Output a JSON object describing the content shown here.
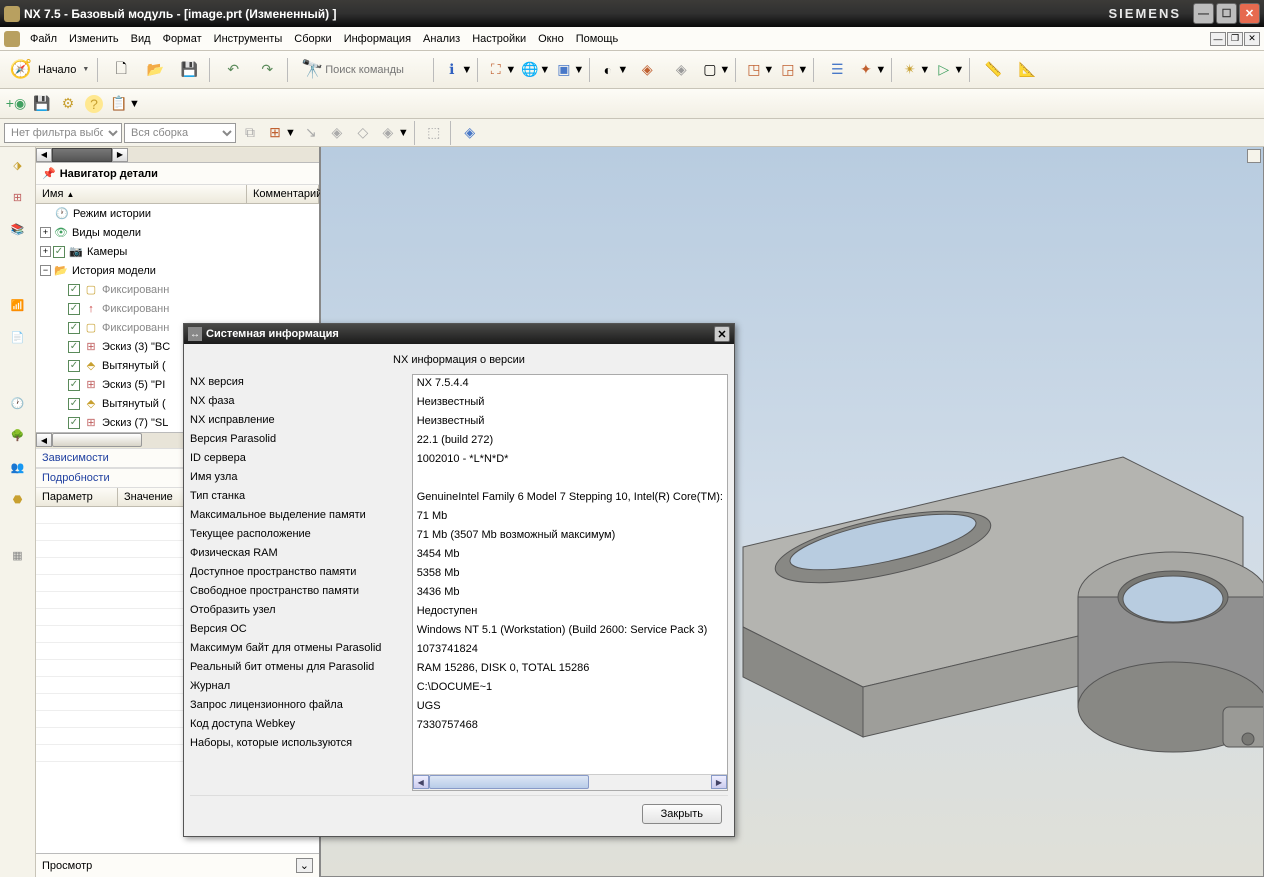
{
  "titlebar": {
    "title": "NX 7.5 - Базовый модуль - [image.prt (Измененный) ]",
    "brand": "SIEMENS"
  },
  "menu": {
    "file": "Файл",
    "edit": "Изменить",
    "view": "Вид",
    "format": "Формат",
    "tools": "Инструменты",
    "assemblies": "Сборки",
    "information": "Информация",
    "analysis": "Анализ",
    "preferences": "Настройки",
    "window": "Окно",
    "help": "Помощь"
  },
  "toolbar": {
    "start": "Начало",
    "search_cmd": "Поиск команды"
  },
  "filter": {
    "no_filter": "Нет фильтра выбо",
    "all_assembly": "Вся сборка"
  },
  "nav": {
    "title": "Навигатор детали",
    "col_name": "Имя",
    "col_comment": "Комментарий",
    "history_mode": "Режим истории",
    "model_views": "Виды модели",
    "cameras": "Камеры",
    "model_history": "История модели",
    "fixed1": "Фиксированн",
    "fixed2": "Фиксированн",
    "fixed3": "Фиксированн",
    "sketch3": "Эскиз (3) \"BC",
    "extrude1": "Вытянутый (",
    "sketch5": "Эскиз (5) \"PI",
    "extrude2": "Вытянутый (",
    "sketch7": "Эскиз (7) \"SL",
    "deps": "Зависимости",
    "details": "Подробности",
    "col_param": "Параметр",
    "col_value": "Значение",
    "preview": "Просмотр"
  },
  "dialog": {
    "title": "Системная информация",
    "subtitle": "NX информация о версии",
    "close_btn": "Закрыть",
    "labels": {
      "nx_version": "NX версия",
      "nx_phase": "NX фаза",
      "nx_fix": "NX исправление",
      "parasolid_ver": "Версия Parasolid",
      "server_id": "ID сервера",
      "node_name": "Имя узла",
      "machine_type": "Тип станка",
      "max_mem": "Максимальное выделение памяти",
      "cur_loc": "Текущее расположение",
      "phys_ram": "Физическая RAM",
      "avail_mem": "Доступное пространство памяти",
      "free_mem": "Свободное пространство памяти",
      "show_node": "Отобразить узел",
      "os_ver": "Версия ОС",
      "max_undo": "Максимум байт для отмены Parasolid",
      "real_undo": "Реальный бит отмены для Parasolid",
      "journal": "Журнал",
      "lic_req": "Запрос лицензионного файла",
      "webkey": "Код доступа Webkey",
      "bundles": "Наборы, которые используются"
    },
    "values": {
      "nx_version": "NX 7.5.4.4",
      "nx_phase": "Неизвестный",
      "nx_fix": "Неизвестный",
      "parasolid_ver": "22.1 (build 272)",
      "server_id": "1002010 - *L*N*D*",
      "node_name": "",
      "machine_type": "GenuineIntel Family 6 Model 7 Stepping 10, Intel(R) Core(TM):",
      "max_mem": "71 Mb",
      "cur_loc": "71 Mb (3507 Mb возможный максимум)",
      "phys_ram": "3454 Mb",
      "avail_mem": "5358 Mb",
      "free_mem": "3436 Mb",
      "show_node": "Недоступен",
      "os_ver": "Windows NT 5.1 (Workstation) (Build 2600: Service Pack 3)",
      "max_undo": "1073741824",
      "real_undo": "RAM 15286, DISK 0, TOTAL 15286",
      "journal": "C:\\DOCUME~1",
      "lic_req": "UGS",
      "webkey": "7330757468",
      "bundles": ""
    }
  }
}
